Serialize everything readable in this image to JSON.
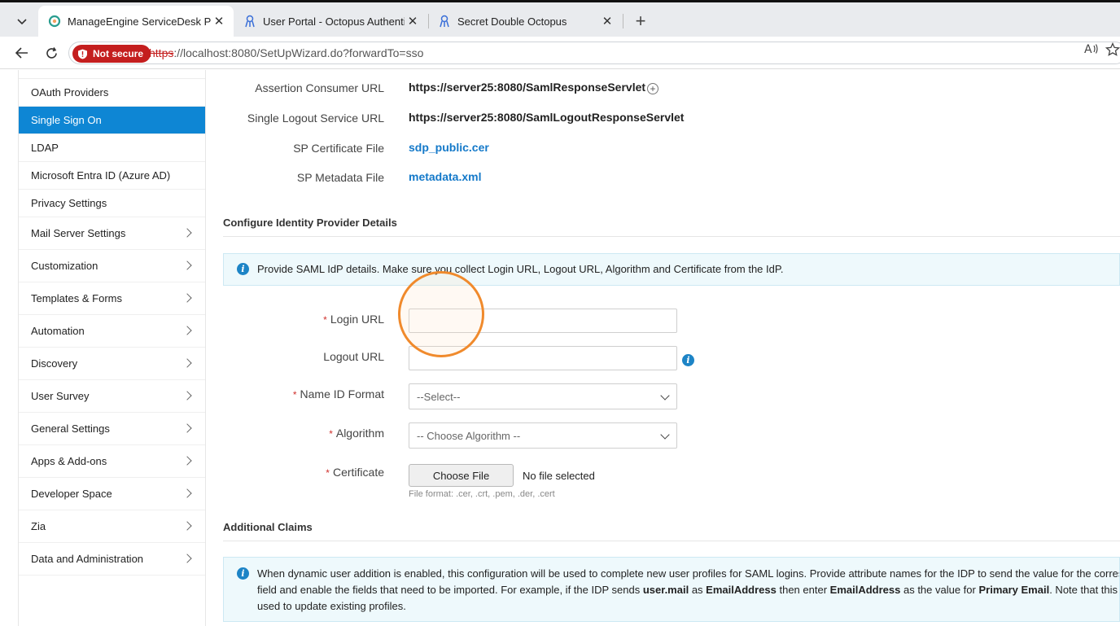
{
  "browser": {
    "tabs": [
      {
        "label": "ManageEngine ServiceDesk Plus",
        "active": true
      },
      {
        "label": "User Portal - Octopus Authenticator",
        "active": false
      },
      {
        "label": "Secret Double Octopus",
        "active": false
      }
    ],
    "security_label": "Not secure",
    "url_scheme": "https",
    "url_rest": "://localhost:8080/SetUpWizard.do?forwardTo=sso"
  },
  "sidebar": {
    "items": [
      {
        "label": "OAuth Providers",
        "active": false,
        "expandable": false
      },
      {
        "label": "Single Sign On",
        "active": true,
        "expandable": false
      },
      {
        "label": "LDAP",
        "active": false,
        "expandable": false
      },
      {
        "label": "Microsoft Entra ID (Azure AD)",
        "active": false,
        "expandable": false
      },
      {
        "label": "Privacy Settings",
        "active": false,
        "expandable": false
      },
      {
        "label": "Mail Server Settings",
        "active": false,
        "expandable": true
      },
      {
        "label": "Customization",
        "active": false,
        "expandable": true
      },
      {
        "label": "Templates & Forms",
        "active": false,
        "expandable": true
      },
      {
        "label": "Automation",
        "active": false,
        "expandable": true
      },
      {
        "label": "Discovery",
        "active": false,
        "expandable": true
      },
      {
        "label": "User Survey",
        "active": false,
        "expandable": true
      },
      {
        "label": "General Settings",
        "active": false,
        "expandable": true
      },
      {
        "label": "Apps & Add-ons",
        "active": false,
        "expandable": true
      },
      {
        "label": "Developer Space",
        "active": false,
        "expandable": true
      },
      {
        "label": "Zia",
        "active": false,
        "expandable": true
      },
      {
        "label": "Data and Administration",
        "active": false,
        "expandable": true
      }
    ]
  },
  "sp_details": {
    "acs_label": "Assertion Consumer URL",
    "acs_value": "https://server25:8080/SamlResponseServlet",
    "slo_label": "Single Logout Service URL",
    "slo_value": "https://server25:8080/SamlLogoutResponseServlet",
    "cert_label": "SP Certificate File",
    "cert_value": "sdp_public.cer",
    "meta_label": "SP Metadata File",
    "meta_value": "metadata.xml"
  },
  "idp": {
    "title": "Configure Identity Provider Details",
    "info": "Provide SAML IdP details. Make sure you collect Login URL, Logout URL, Algorithm and Certificate from the IdP.",
    "login_label": "Login URL",
    "login_value": "",
    "logout_label": "Logout URL",
    "logout_value": "",
    "nameid_label": "Name ID Format",
    "nameid_value": "--Select--",
    "algo_label": "Algorithm",
    "algo_value": "-- Choose Algorithm --",
    "cert_label": "Certificate",
    "choose_file": "Choose File",
    "no_file": "No file selected",
    "file_hint": "File format: .cer, .crt, .pem, .der, .cert",
    "required_mark": "*"
  },
  "claims": {
    "title": "Additional Claims",
    "line1": "When dynamic user addition is enabled, this configuration will be used to complete new user profiles for SAML logins. Provide attribute names for the IDP to send the value for the corresponding",
    "line2_a": "field and enable the fields that need to be imported. For example, if the IDP sends ",
    "line2_b": "user.mail",
    "line2_c": " as ",
    "line2_d": "EmailAddress",
    "line2_e": " then enter ",
    "line2_f": "EmailAddress",
    "line2_g": " as the value for ",
    "line2_h": "Primary Email",
    "line2_i": ". Note that this configuration will not be",
    "line3": "used to update existing profiles."
  }
}
